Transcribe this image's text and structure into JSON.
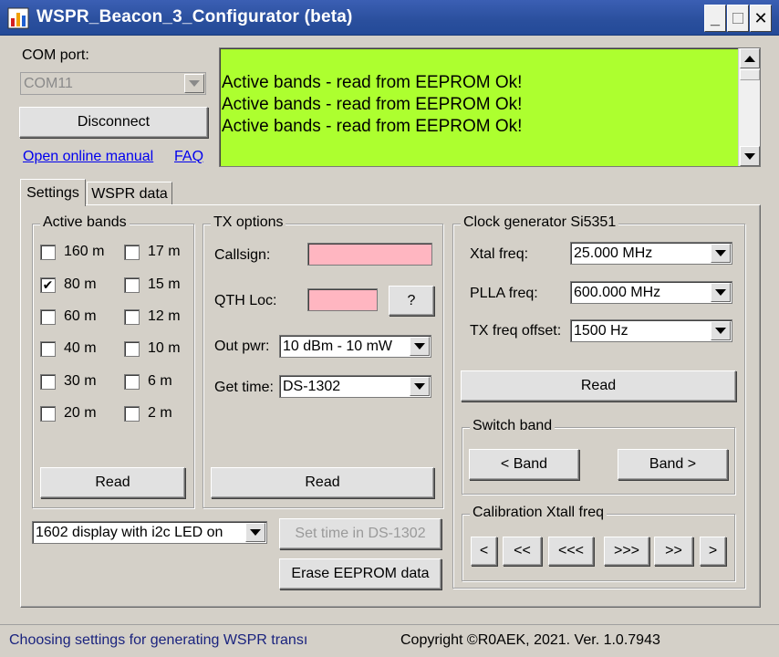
{
  "window": {
    "title": "WSPR_Beacon_3_Configurator (beta)",
    "minimize": "_",
    "maximize": "□",
    "close": "✕"
  },
  "com": {
    "label": "COM port:",
    "value": "COM11",
    "disconnect": "Disconnect",
    "manual_link": "Open online manual",
    "faq_link": "FAQ"
  },
  "log": {
    "lines": [
      "Active bands - read from EEPROM Ok!",
      "Active bands - read from EEPROM Ok!",
      "Active bands - read from EEPROM Ok!"
    ],
    "background": "#adff2f"
  },
  "tabs": [
    {
      "label": "Settings",
      "selected": true
    },
    {
      "label": "WSPR data",
      "selected": false
    }
  ],
  "active_bands": {
    "title": "Active bands",
    "bands": [
      {
        "label": "160 m",
        "checked": false
      },
      {
        "label": "17 m",
        "checked": false
      },
      {
        "label": "80 m",
        "checked": true
      },
      {
        "label": "15 m",
        "checked": false
      },
      {
        "label": "60 m",
        "checked": false
      },
      {
        "label": "12 m",
        "checked": false
      },
      {
        "label": "40 m",
        "checked": false
      },
      {
        "label": "10 m",
        "checked": false
      },
      {
        "label": "30 m",
        "checked": false
      },
      {
        "label": "6 m",
        "checked": false
      },
      {
        "label": "20 m",
        "checked": false
      },
      {
        "label": "2 m",
        "checked": false
      }
    ],
    "read": "Read",
    "check_mark": "✔"
  },
  "tx_options": {
    "title": "TX options",
    "callsign_label": "Callsign:",
    "callsign_value": "",
    "qth_label": "QTH Loc:",
    "qth_value": "",
    "qth_help": "?",
    "out_pwr_label": "Out pwr:",
    "out_pwr_value": "10 dBm - 10 mW",
    "get_time_label": "Get time:",
    "get_time_value": "DS-1302",
    "read": "Read",
    "input_color": "#ffb6c1"
  },
  "clock": {
    "title": "Clock generator Si5351",
    "xtal_label": "Xtal freq:",
    "xtal_value": "25.000 MHz",
    "plla_label": "PLLA freq:",
    "plla_value": "600.000 MHz",
    "offset_label": "TX freq offset:",
    "offset_value": "1500 Hz",
    "read": "Read",
    "switch_band": {
      "title": "Switch band",
      "prev": "< Band",
      "next": "Band >"
    },
    "calibration": {
      "title": "Calibration Xtall freq",
      "buttons": [
        "<",
        "<<",
        "<<<",
        ">>>",
        ">>",
        ">"
      ]
    }
  },
  "bottom": {
    "display_value": "1602 display with i2c LED on",
    "set_time": "Set time in DS-1302",
    "erase": "Erase EEPROM data"
  },
  "status": {
    "message": "Choosing settings for generating WSPR transı",
    "copyright": "Copyright ©R0AEK, 2021. Ver. 1.0.7943"
  }
}
